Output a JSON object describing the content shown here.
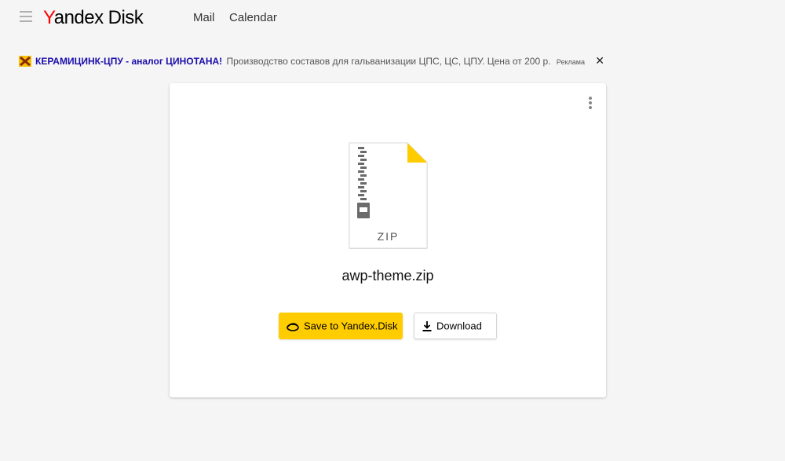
{
  "header": {
    "menu_icon": "hamburger-icon",
    "logo_y": "Y",
    "logo_andex": "andex",
    "logo_disk": "Disk",
    "nav": [
      {
        "label": "Mail"
      },
      {
        "label": "Calendar"
      }
    ]
  },
  "ad": {
    "icon": "ad-favicon",
    "title": "КЕРАМИЦИНК-ЦПУ - аналог ЦИНОТАНА!",
    "text": "Производство составов для гальванизации ЦПС, ЦС, ЦПУ. Цена от 200 р.",
    "label": "Реклама",
    "close": "✕"
  },
  "card": {
    "more_icon": "more-vertical-icon",
    "file": {
      "extension": "ZIP",
      "name": "awp-theme.zip"
    },
    "buttons": {
      "save": "Save to Yandex.Disk",
      "download": "Download"
    }
  },
  "colors": {
    "background": "#f5f5f5",
    "accent": "#ffcc00",
    "logo_red": "#ff0000",
    "ad_link": "#1a0dab"
  }
}
